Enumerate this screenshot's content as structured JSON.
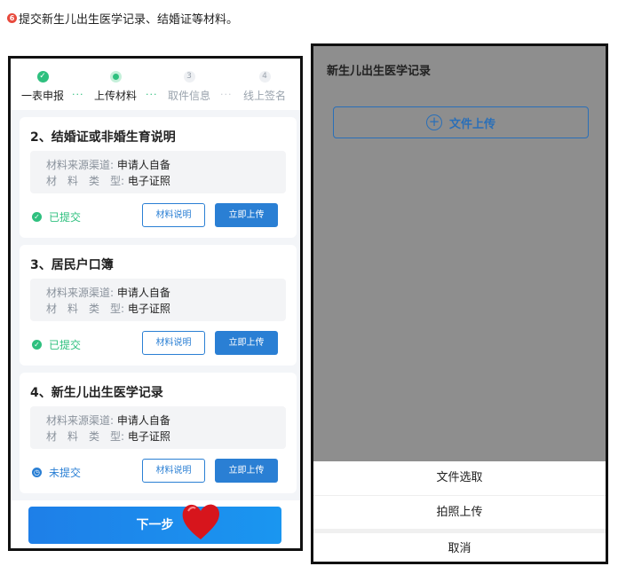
{
  "caption": {
    "number": "6",
    "text": "提交新生儿出生医学记录、结婚证等材料。"
  },
  "left_phone": {
    "steps": [
      {
        "label": "一表申报",
        "status": "done",
        "marker": "✓"
      },
      {
        "label": "上传材料",
        "status": "current",
        "marker": ""
      },
      {
        "label": "取件信息",
        "status": "todo",
        "marker": "3"
      },
      {
        "label": "线上签名",
        "status": "todo",
        "marker": "4"
      }
    ],
    "cards": [
      {
        "title": "2、结婚证或非婚生育说明",
        "source_label": "材料来源渠道:",
        "source_value": "申请人自备",
        "type_label": "材　料　类　型:",
        "type_value": "电子证照",
        "status": "已提交",
        "status_kind": "ok",
        "explain_label": "材料说明",
        "upload_label": "立即上传"
      },
      {
        "title": "3、居民户口簿",
        "source_label": "材料来源渠道:",
        "source_value": "申请人自备",
        "type_label": "材　料　类　型:",
        "type_value": "电子证照",
        "status": "已提交",
        "status_kind": "ok",
        "explain_label": "材料说明",
        "upload_label": "立即上传"
      },
      {
        "title": "4、新生儿出生医学记录",
        "source_label": "材料来源渠道:",
        "source_value": "申请人自备",
        "type_label": "材　料　类　型:",
        "type_value": "电子证照",
        "status": "未提交",
        "status_kind": "pend",
        "explain_label": "材料说明",
        "upload_label": "立即上传"
      }
    ],
    "next_label": "下一步"
  },
  "right_phone": {
    "title": "新生儿出生医学记录",
    "upload_label": "文件上传",
    "sheet": {
      "file_select": "文件选取",
      "photo_upload": "拍照上传",
      "cancel": "取消"
    }
  },
  "colors": {
    "accent_blue": "#2a7fd4",
    "success_green": "#2fc07f",
    "heart_red": "#d7151c"
  }
}
